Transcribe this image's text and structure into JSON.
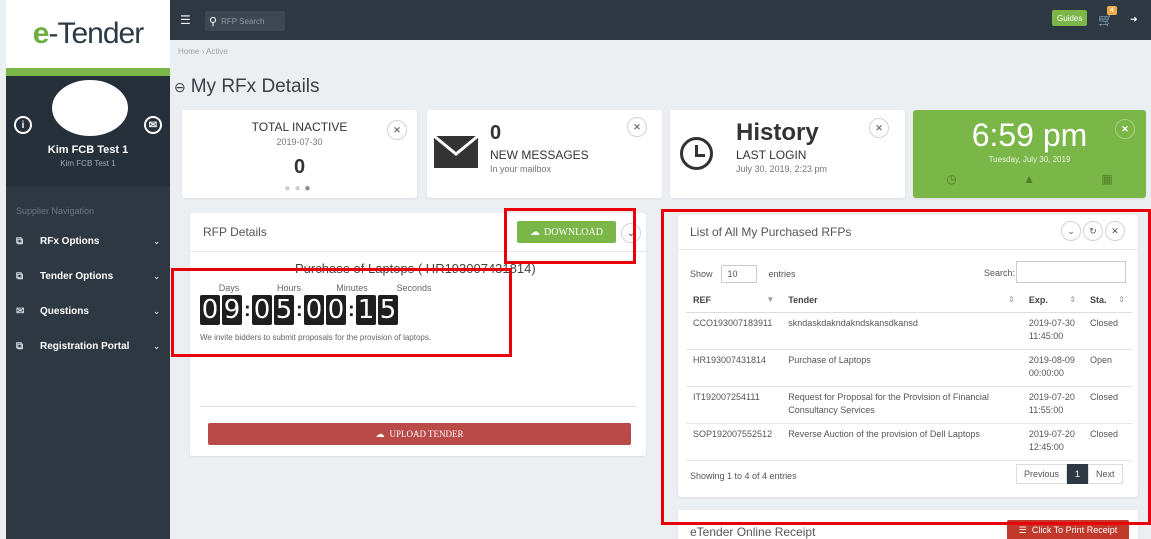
{
  "logo": {
    "e": "e",
    "rest": "-Tender"
  },
  "topbar": {
    "search_placeholder": "RFP Search",
    "guides": "Guides",
    "cart_count": "4"
  },
  "breadcrumb": "Home  ›  Active",
  "profile": {
    "name": "Kim FCB Test 1",
    "sub": "Kim FCB Test 1"
  },
  "sidebar": {
    "heading": "Supplier Navigation",
    "items": [
      {
        "label": "RFx Options"
      },
      {
        "label": "Tender Options"
      },
      {
        "label": "Questions"
      },
      {
        "label": "Registration Portal"
      }
    ]
  },
  "page_title": "My RFx Details",
  "stats": {
    "inactive": {
      "title": "TOTAL INACTIVE",
      "date": "2019-07-30",
      "value": "0"
    },
    "messages": {
      "value": "0",
      "label": "NEW MESSAGES",
      "sub": "In your mailbox"
    },
    "history": {
      "title": "History",
      "label": "LAST LOGIN",
      "sub": "July 30, 2019, 2:23 pm"
    },
    "time": {
      "time": "6:59 pm",
      "date": "Tuesday, July 30, 2019"
    }
  },
  "rfp": {
    "header": "RFP Details",
    "download": "DOWNLOAD",
    "title": "Purchase of Laptops ( HR193007431814)",
    "labels": {
      "days": "Days",
      "hours": "Hours",
      "minutes": "Minutes",
      "seconds": "Seconds"
    },
    "digits": [
      "0",
      "9",
      "0",
      "5",
      "0",
      "0",
      "1",
      "5"
    ],
    "invite": "We invite bidders to submit proposals for the provision of laptops.",
    "upload": "UPLOAD TENDER"
  },
  "list": {
    "header": "List of All My Purchased RFPs",
    "show": "Show",
    "entries_value": "10",
    "entries": "entries",
    "search": "Search:",
    "columns": [
      "REF",
      "Tender",
      "Exp.",
      "Sta."
    ],
    "rows": [
      {
        "ref": "CCO193007183911",
        "tender": "skndaskdakndakndskansdkansd",
        "exp": "2019-07-30 11:45:00",
        "status": "Closed"
      },
      {
        "ref": "HR193007431814",
        "tender": "Purchase of Laptops",
        "exp": "2019-08-09 00:00:00",
        "status": "Open"
      },
      {
        "ref": "IT192007254111",
        "tender": "Request for Proposal for the Provision of Financial Consultancy Services",
        "exp": "2019-07-20 11:55:00",
        "status": "Closed"
      },
      {
        "ref": "SOP192007552512",
        "tender": "Reverse Auction of the provision of Dell Laptops",
        "exp": "2019-07-20 12:45:00",
        "status": "Closed"
      }
    ],
    "showing": "Showing 1 to 4 of 4 entries",
    "pager": {
      "prev": "Previous",
      "page": "1",
      "next": "Next"
    }
  },
  "receipt": {
    "header": "eTender Online Receipt",
    "print": "Click To Print Receipt"
  }
}
